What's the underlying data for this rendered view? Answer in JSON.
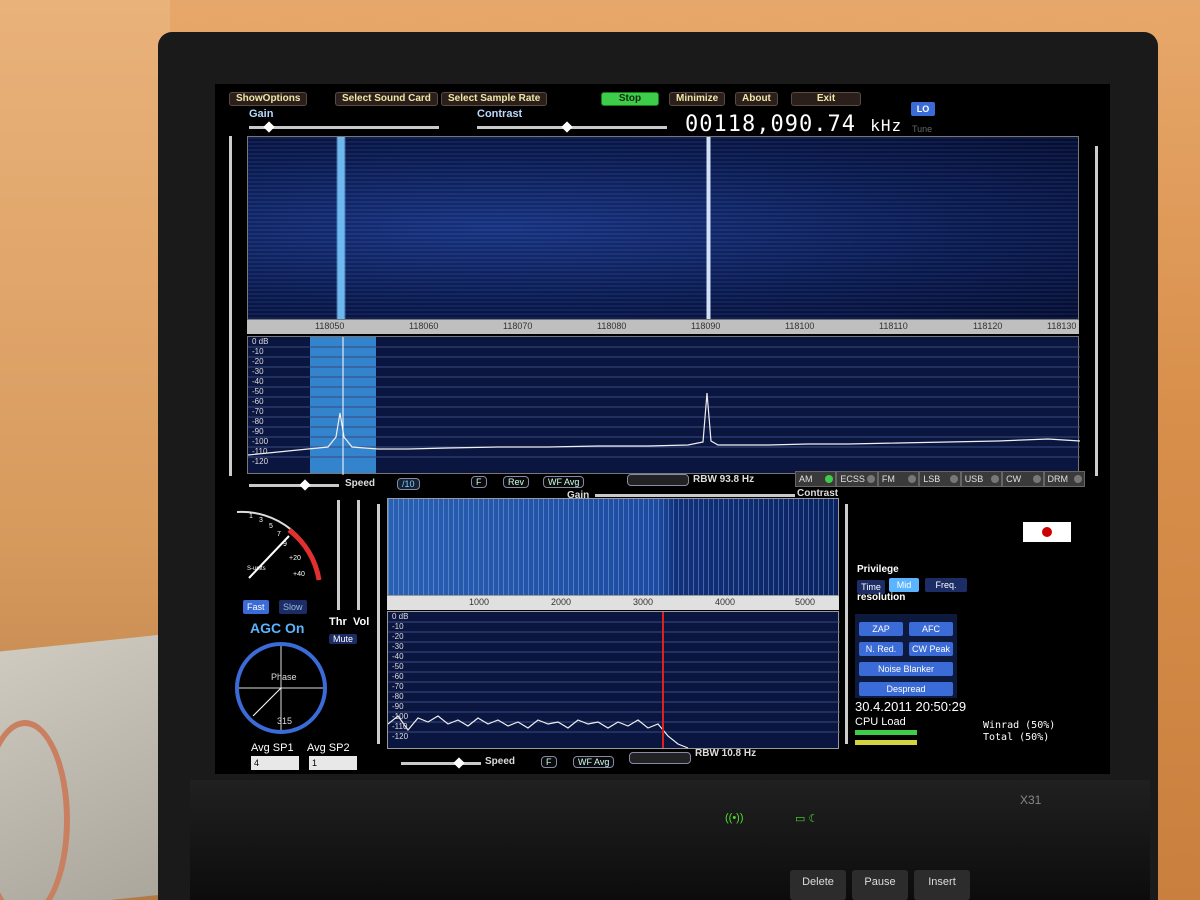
{
  "toolbar": {
    "show_options": "ShowOptions",
    "select_sound_card": "Select Sound Card",
    "select_sample_rate": "Select Sample Rate",
    "stop": "Stop",
    "minimize": "Minimize",
    "about": "About",
    "exit": "Exit"
  },
  "sliders": {
    "gain": "Gain",
    "contrast": "Contrast"
  },
  "frequency": {
    "value": "00118,090.74",
    "unit": "kHz"
  },
  "lo_button": "LO",
  "tune_label": "Tune",
  "waterfall_axis": {
    "ticks": [
      "118050",
      "118060",
      "118070",
      "118080",
      "118090",
      "118100",
      "118110",
      "118120",
      "118130"
    ]
  },
  "spectrum": {
    "db_labels": [
      "0 dB",
      "-10",
      "-20",
      "-30",
      "-40",
      "-50",
      "-60",
      "-70",
      "-80",
      "-90",
      "-100",
      "-110",
      "-120"
    ]
  },
  "controls": {
    "speed": "Speed",
    "div10": "/10",
    "f": "F",
    "rev": "Rev",
    "wf_avg": "WF Avg",
    "rbw": "RBW 93.8 Hz",
    "gain": "Gain",
    "contrast": "Contrast"
  },
  "modes": [
    "AM",
    "ECSS",
    "FM",
    "LSB",
    "USB",
    "CW",
    "DRM"
  ],
  "active_mode": "AM",
  "smeter": {
    "labels": [
      "1",
      "3",
      "5",
      "7",
      "9",
      "+20",
      "+40"
    ],
    "units": "S-units"
  },
  "agc": {
    "fast": "Fast",
    "slow": "Slow",
    "status": "AGC On"
  },
  "phase": {
    "label": "Phase",
    "value": "315"
  },
  "thr": "Thr",
  "vol": "Vol",
  "mute": "Mute",
  "avg": {
    "sp1_label": "Avg SP1",
    "sp1_value": "4",
    "sp2_label": "Avg SP2",
    "sp2_value": "1"
  },
  "audio_axis": {
    "ticks": [
      "1000",
      "2000",
      "3000",
      "4000",
      "5000"
    ]
  },
  "audio_spectrum": {
    "db_labels": [
      "0 dB",
      "-10",
      "-20",
      "-30",
      "-40",
      "-50",
      "-60",
      "-70",
      "-80",
      "-90",
      "-100",
      "-110",
      "-120"
    ]
  },
  "audio_controls": {
    "speed": "Speed",
    "f": "F",
    "wf_avg": "WF Avg",
    "rbw": "RBW 10.8 Hz"
  },
  "privilege": {
    "title": "Privilege",
    "time": "Time",
    "mid": "Mid",
    "freq": "Freq.",
    "resolution": "resolution"
  },
  "dsp": {
    "zap": "ZAP",
    "afc": "AFC",
    "n_red": "N. Red.",
    "cw_peak": "CW Peak",
    "noise_blanker": "Noise Blanker",
    "despread": "Despread"
  },
  "datetime": "30.4.2011  20:50:29",
  "cpu": {
    "label": "CPU Load",
    "winrad": "Winrad",
    "winrad_pct": "(50%)",
    "total": "Total",
    "total_pct": "(50%)"
  },
  "laptop": {
    "model": "X31"
  },
  "keyboard": [
    "Delete",
    "Pause",
    "Insert"
  ]
}
